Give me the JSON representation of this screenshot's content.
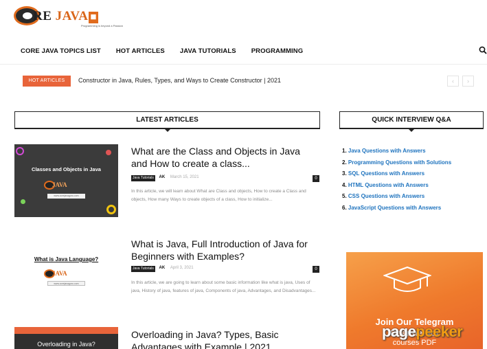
{
  "logo": {
    "text_pre": "C",
    "text_mid": "RE ",
    "text_java": "JAVA",
    "tagline": "Programming is beyond a Passion"
  },
  "nav": {
    "items": [
      {
        "label": "CORE JAVA TOPICS LIST"
      },
      {
        "label": "HOT ARTICLES"
      },
      {
        "label": "JAVA TUTORIALS"
      },
      {
        "label": "PROGRAMMING"
      }
    ]
  },
  "ticker": {
    "badge": "HOT ARTICLES",
    "text": "Constructor in Java, Rules, Types, and Ways to Create Constructor | 2021"
  },
  "sections": {
    "latest": "LATEST ARTICLES",
    "quick": "QUICK INTERVIEW Q&A"
  },
  "articles": [
    {
      "thumb_title": "Classes and Objects in Java",
      "thumb_url": "www.corejavaguru.com",
      "title": "What are the Class and Objects in Java and How to create a class...",
      "category": "Java Tutorials",
      "author": "AK",
      "date": "March 15, 2021",
      "comments": "0",
      "excerpt": "In this article, we will learn about What are Class and objects, How to create a Class and objects, How many Ways to create objects of a class, How to initialize..."
    },
    {
      "thumb_title": "What is Java Language?",
      "thumb_url": "www.corejavaguru.com",
      "title": "What is Java, Full Introduction of Java for Beginners with Examples?",
      "category": "Java Tutorials",
      "author": "AK",
      "date": "April 3, 2021",
      "comments": "0",
      "excerpt": "In this article, we are going to learn about some basic information like what is java, Uses of java, History of java, features of java, Components of java, Advantages, and Disadvantages..."
    },
    {
      "thumb_title": "Overloading in Java?",
      "title": "Overloading in Java? Types, Basic Advantages with Example | 2021"
    }
  ],
  "quick": {
    "items": [
      {
        "num": "1.",
        "label": "Java Questions with Answers"
      },
      {
        "num": "2.",
        "label": "Programming Questions with Solutions"
      },
      {
        "num": "3.",
        "label": "SQL Questions with Answers"
      },
      {
        "num": "4.",
        "label": "HTML Questions with Answers"
      },
      {
        "num": "5.",
        "label": "CSS Questions with Answers"
      },
      {
        "num": "6.",
        "label": "JavaScript Questions with Answers"
      }
    ]
  },
  "banner": {
    "line1": "Join Our Telegram",
    "line2": "Channel for",
    "line3": "courses PDF"
  },
  "watermark": {
    "page": "page",
    "peeker": "peeker"
  },
  "colors": {
    "accent": "#e8643a",
    "link": "#1e73be",
    "dark": "#222222"
  }
}
